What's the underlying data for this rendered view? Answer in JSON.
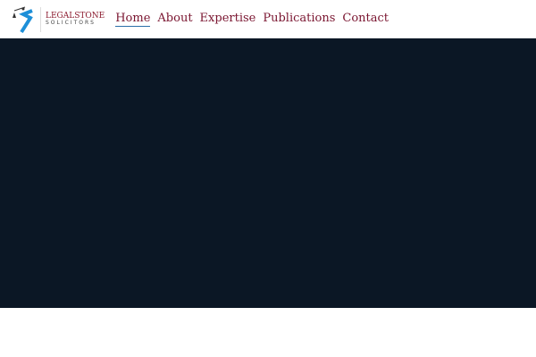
{
  "logo": {
    "line1": "LEGALSTONE",
    "line2": "SOLICITORS"
  },
  "nav": [
    {
      "label": "Home",
      "active": true
    },
    {
      "label": "About"
    },
    {
      "label": "Expertise"
    },
    {
      "label": "Publications"
    },
    {
      "label": "Contact"
    }
  ],
  "colors": {
    "hero": "#0b1725",
    "nav_text": "#7a1530",
    "active_underline": "#2a6fa8"
  }
}
